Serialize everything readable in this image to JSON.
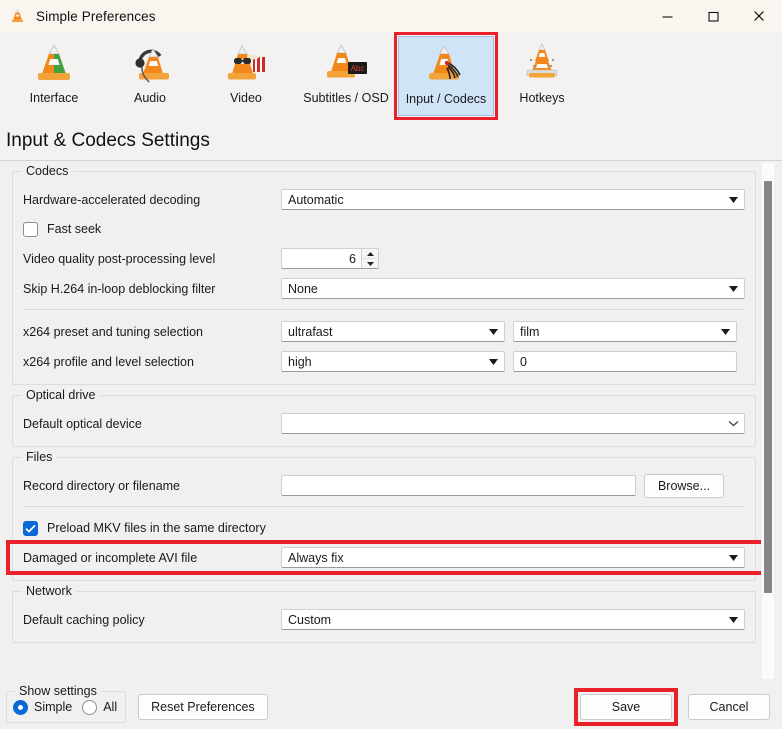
{
  "window": {
    "title": "Simple Preferences",
    "icon": "vlc-cone-icon",
    "controls": {
      "minimize": "minimize-icon",
      "maximize": "maximize-icon",
      "close": "close-icon"
    }
  },
  "toolbar": {
    "categories": [
      {
        "label": "Interface",
        "icon": "vlc-cone-icon",
        "selected": false
      },
      {
        "label": "Audio",
        "icon": "vlc-cone-headphones-icon",
        "selected": false
      },
      {
        "label": "Video",
        "icon": "vlc-cone-glasses-icon",
        "selected": false
      },
      {
        "label": "Subtitles / OSD",
        "icon": "vlc-cone-subtitles-icon",
        "selected": false
      },
      {
        "label": "Input / Codecs",
        "icon": "vlc-cone-codecs-icon",
        "selected": true
      },
      {
        "label": "Hotkeys",
        "icon": "vlc-cone-keyboard-icon",
        "selected": false
      }
    ],
    "highlight_color": "#e8212a",
    "selected_background": "#cfe4f7"
  },
  "page": {
    "title": "Input & Codecs Settings"
  },
  "sections": {
    "codecs": {
      "legend": "Codecs",
      "hardware_decoding": {
        "label": "Hardware-accelerated decoding",
        "value": "Automatic"
      },
      "fast_seek": {
        "label": "Fast seek",
        "checked": false
      },
      "post_processing": {
        "label": "Video quality post-processing level",
        "value": "6"
      },
      "deblocking": {
        "label": "Skip H.264 in-loop deblocking filter",
        "value": "None"
      },
      "x264_preset": {
        "label": "x264 preset and tuning selection",
        "value": "ultrafast",
        "value2": "film"
      },
      "x264_profile": {
        "label": "x264 profile and level selection",
        "value": "high",
        "value2": "0"
      }
    },
    "optical_drive": {
      "legend": "Optical drive",
      "default_device": {
        "label": "Default optical device",
        "value": ""
      }
    },
    "files": {
      "legend": "Files",
      "record_dir": {
        "label": "Record directory or filename",
        "value": ""
      },
      "browse_label": "Browse...",
      "preload_mkv": {
        "label": "Preload MKV files in the same directory",
        "checked": true
      },
      "avi_file": {
        "label": "Damaged or incomplete AVI file",
        "value": "Always fix",
        "highlighted": true
      }
    },
    "network": {
      "legend": "Network",
      "caching_policy": {
        "label": "Default caching policy",
        "value": "Custom"
      }
    }
  },
  "bottom": {
    "show_settings_legend": "Show settings",
    "simple_label": "Simple",
    "all_label": "All",
    "selected_mode": "Simple",
    "reset_label": "Reset Preferences",
    "save_label": "Save",
    "cancel_label": "Cancel",
    "save_highlighted": true
  }
}
